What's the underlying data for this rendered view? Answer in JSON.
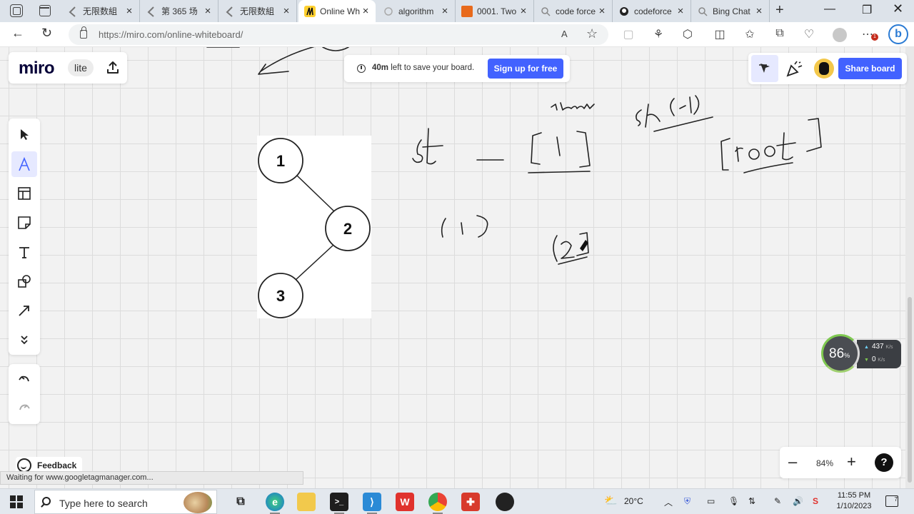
{
  "browser": {
    "tabs": [
      {
        "title": "无限数組",
        "icon": "leetcode-icon"
      },
      {
        "title": "第 365 场",
        "icon": "leetcode-icon"
      },
      {
        "title": "无限数組",
        "icon": "leetcode-icon"
      },
      {
        "title": "Online Wh",
        "icon": "miro-icon",
        "active": true
      },
      {
        "title": "algorithm",
        "icon": "loading-icon"
      },
      {
        "title": "0001. Two",
        "icon": "book-icon"
      },
      {
        "title": "code force",
        "icon": "search-icon"
      },
      {
        "title": "codeforce",
        "icon": "github-icon"
      },
      {
        "title": "Bing Chat",
        "icon": "search-icon"
      }
    ],
    "url": "https://miro.com/online-whiteboard/",
    "read_aloud": "A",
    "notification_count": "1",
    "bing_label": "b"
  },
  "miro": {
    "logo": "miro",
    "lite_badge": "lite",
    "save_notice_bold": "40m",
    "save_notice_rest": "left to save your board.",
    "signup_label": "Sign up for free",
    "share_label": "Share board",
    "zoom_level": "84%",
    "zoom_minus": "–",
    "zoom_plus": "+",
    "help": "?",
    "feedback_label": "Feedback"
  },
  "tree": {
    "nodes": [
      "1",
      "2",
      "3"
    ]
  },
  "status_bar": "Waiting for www.googletagmanager.com...",
  "net_speed": {
    "percent": "86",
    "percent_sign": "%",
    "upload": "437",
    "download": "0",
    "unit": "K/s"
  },
  "taskbar": {
    "search_placeholder": "Type here to search",
    "weather": "20°C",
    "time": "11:55 PM",
    "date": "1/10/2023",
    "notifications": "7"
  },
  "colors": {
    "accent": "#4262ff",
    "miro_yellow": "#ffd02f",
    "tool_active_bg": "#e6e9ff"
  }
}
